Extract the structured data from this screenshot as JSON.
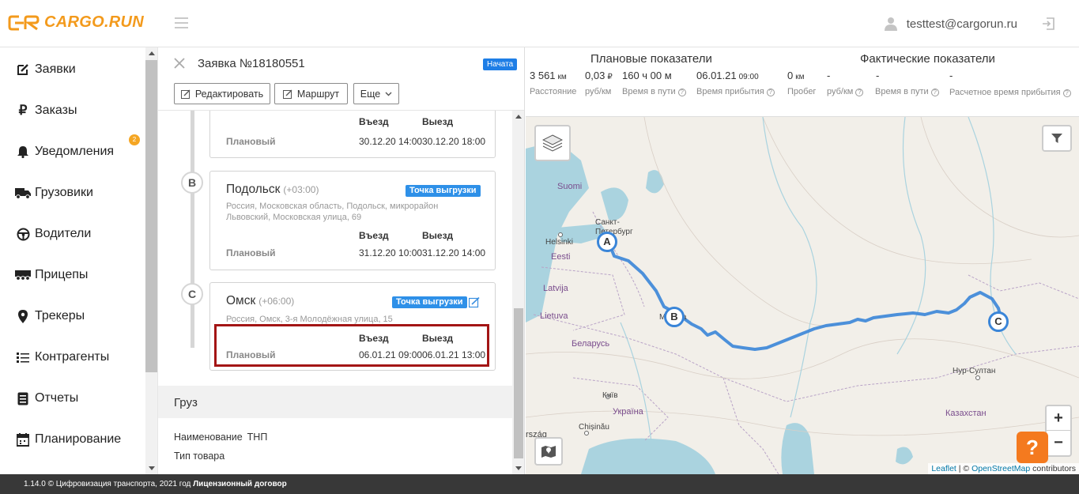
{
  "header": {
    "logo_text": "CARGO.RUN",
    "user_email": "testtest@cargorun.ru"
  },
  "sidebar": {
    "items": [
      {
        "label": "Заявки",
        "icon": "edit-icon"
      },
      {
        "label": "Заказы",
        "icon": "ruble-icon"
      },
      {
        "label": "Уведомления",
        "icon": "bell-icon",
        "badge": "2"
      },
      {
        "label": "Грузовики",
        "icon": "truck-icon"
      },
      {
        "label": "Водители",
        "icon": "steering-wheel-icon"
      },
      {
        "label": "Прицепы",
        "icon": "trailer-icon"
      },
      {
        "label": "Трекеры",
        "icon": "map-pin-icon"
      },
      {
        "label": "Контрагенты",
        "icon": "contacts-icon"
      },
      {
        "label": "Отчеты",
        "icon": "document-icon"
      },
      {
        "label": "Планирование",
        "icon": "calendar-icon"
      }
    ]
  },
  "order": {
    "title": "Заявка №18180551",
    "status": "Начата",
    "buttons": {
      "edit": "Редактировать",
      "route": "Маршрут",
      "more": "Еще"
    },
    "col_entry": "Въезд",
    "col_exit": "Выезд",
    "row_planned": "Плановый",
    "stops": [
      {
        "letter": "A",
        "entry": "30.12.20 14:00",
        "exit": "30.12.20 18:00"
      },
      {
        "letter": "B",
        "city": "Подольск",
        "tz": "(+03:00)",
        "tag": "Точка выгрузки",
        "address": "Россия, Московская область, Подольск, микрорайон Львовский, Московская улица, 69",
        "entry": "31.12.20 10:00",
        "exit": "31.12.20 14:00"
      },
      {
        "letter": "C",
        "city": "Омск",
        "tz": "(+06:00)",
        "tag": "Точка выгрузки",
        "address": "Россия, Омск, 3-я Молодёжная улица, 15",
        "entry": "06.01.21 09:00",
        "exit": "06.01.21 13:00"
      }
    ],
    "cargo": {
      "title": "Груз",
      "name_label": "Наименование",
      "name_value": "ТНП",
      "type_label": "Тип товара"
    }
  },
  "stats": {
    "planned_title": "Плановые показатели",
    "actual_title": "Фактические показатели",
    "planned": {
      "distance": "3 561",
      "distance_unit": "км",
      "rate": "0,03",
      "rate_unit": "₽",
      "time": "160 ч 00 м",
      "arrival": "06.01.21",
      "arrival_time": "09:00"
    },
    "actual": {
      "mileage": "0",
      "mileage_unit": "км",
      "rate": "-",
      "time": "-",
      "arrival": "-"
    },
    "labels": {
      "distance": "Расстояние",
      "rate": "руб/км",
      "time": "Время в пути",
      "arrival": "Время прибытия",
      "mileage": "Пробег",
      "rate2": "руб/км",
      "time2": "Время в пути",
      "eta": "Расчетное время прибытия"
    },
    "help_glyph": "?"
  },
  "map": {
    "labels": [
      "Suomi",
      "Санкт-Петербург",
      "Helsinki",
      "Eesti",
      "Latvija",
      "Lietuva",
      "Беларусь",
      "Київ",
      "Україна",
      "Chișinău",
      "Moskva",
      "Нур-Султан",
      "Казахстан",
      "rszág"
    ],
    "zoom_in": "+",
    "zoom_out": "−",
    "help": "?",
    "attribution": {
      "leaflet": "Leaflet",
      "sep": " | © ",
      "osm": "OpenStreetMap",
      "rest": " contributors"
    },
    "route_color": "#3a85d8"
  },
  "footer": {
    "text": "1.14.0 © Цифровизация транспорта, 2021 год ",
    "license": "Лицензионный договор"
  }
}
